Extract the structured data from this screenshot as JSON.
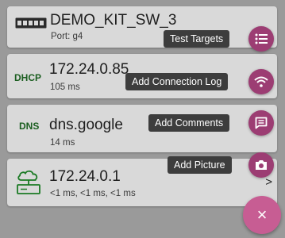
{
  "colors": {
    "accent": "#9c3d73",
    "main_fab": "#c75d93",
    "tag_green": "#1b5e20",
    "tooltip_bg": "#3d3d3d"
  },
  "cards": [
    {
      "icon": "switch-icon",
      "title": "DEMO_KIT_SW_3",
      "sub": "Port: g4"
    },
    {
      "tag": "DHCP",
      "title": "172.24.0.85",
      "sub": "105 ms"
    },
    {
      "tag": "DNS",
      "title": "dns.google",
      "sub": "14 ms"
    },
    {
      "icon": "gateway-icon",
      "title": "172.24.0.1",
      "sub": "<1 ms, <1 ms, <1 ms",
      "chevron": ">"
    }
  ],
  "fab_menu": [
    {
      "label": "Test Targets",
      "icon": "list-icon"
    },
    {
      "label": "Add Connection Log",
      "icon": "wifi-icon"
    },
    {
      "label": "Add Comments",
      "icon": "comment-icon"
    },
    {
      "label": "Add Picture",
      "icon": "camera-icon"
    }
  ],
  "close_fab": {
    "label": "×",
    "icon": "close-icon"
  }
}
